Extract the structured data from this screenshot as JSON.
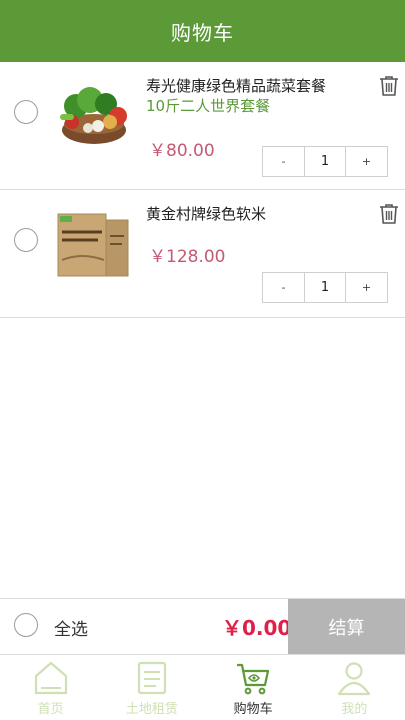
{
  "header": {
    "title": "购物车"
  },
  "cart_items": [
    {
      "name": "寿光健康绿色精品蔬菜套餐",
      "subtitle": "10斤二人世界套餐",
      "price": "￥80.00",
      "quantity": "1",
      "minus_label": "-",
      "plus_label": "+"
    },
    {
      "name": "黄金村牌绿色软米",
      "subtitle": "",
      "price": "￥128.00",
      "quantity": "1",
      "minus_label": "-",
      "plus_label": "+"
    }
  ],
  "footer": {
    "select_all_label": "全选",
    "total": "￥0.00",
    "checkout_label": "结算"
  },
  "tabs": [
    {
      "label": "首页",
      "icon": "home-icon"
    },
    {
      "label": "土地租赁",
      "icon": "land-lease-icon"
    },
    {
      "label": "购物车",
      "icon": "cart-icon"
    },
    {
      "label": "我的",
      "icon": "user-icon"
    }
  ],
  "colors": {
    "header_bg": "#5b9a37",
    "accent_green": "#5b9a37",
    "price_pink": "#c45a74",
    "total_red": "#e0204a",
    "checkout_gray": "#b5b5b5",
    "tab_inactive": "#cfe0b5"
  }
}
